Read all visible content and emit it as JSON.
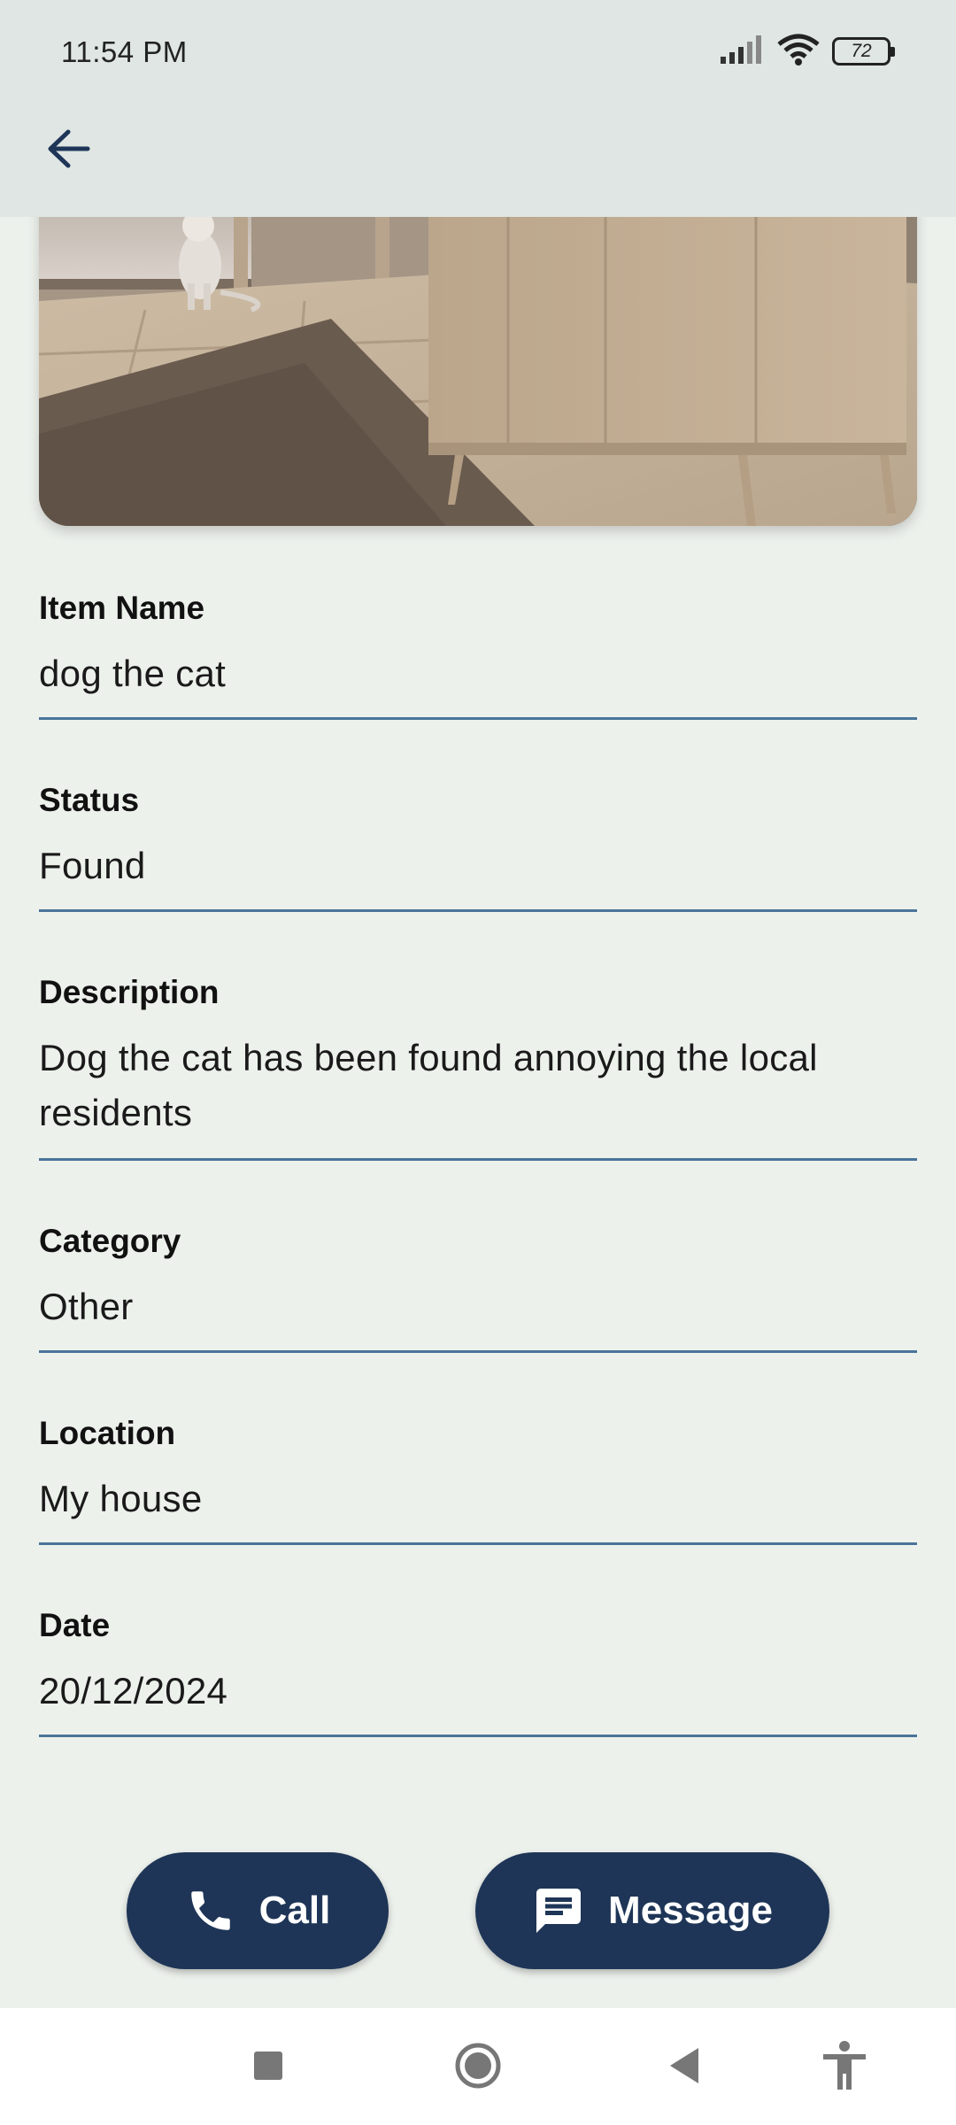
{
  "status_bar": {
    "time": "11:54 PM",
    "battery": "72",
    "icons": [
      "signal-icon",
      "wifi-icon",
      "battery-icon"
    ]
  },
  "app_bar": {
    "back_icon": "arrow-left-icon"
  },
  "hero": {
    "image": "room-with-cat-and-tv-cabinet"
  },
  "fields": {
    "item_name": {
      "label": "Item Name",
      "value": "dog the cat"
    },
    "status": {
      "label": "Status",
      "value": "Found"
    },
    "description": {
      "label": "Description",
      "value": "Dog the cat has been found annoying the local residents"
    },
    "category": {
      "label": "Category",
      "value": "Other"
    },
    "location": {
      "label": "Location",
      "value": "My house"
    },
    "date": {
      "label": "Date",
      "value": "20/12/2024"
    }
  },
  "actions": {
    "call_label": "Call",
    "message_label": "Message"
  },
  "nav": {
    "icons": [
      "recents-square-icon",
      "home-circle-icon",
      "back-triangle-icon",
      "accessibility-icon"
    ]
  },
  "colors": {
    "accent": "#1e3557",
    "underline": "#4a7499",
    "background": "#edf1ec",
    "app_bar": "#dfe6e3"
  }
}
